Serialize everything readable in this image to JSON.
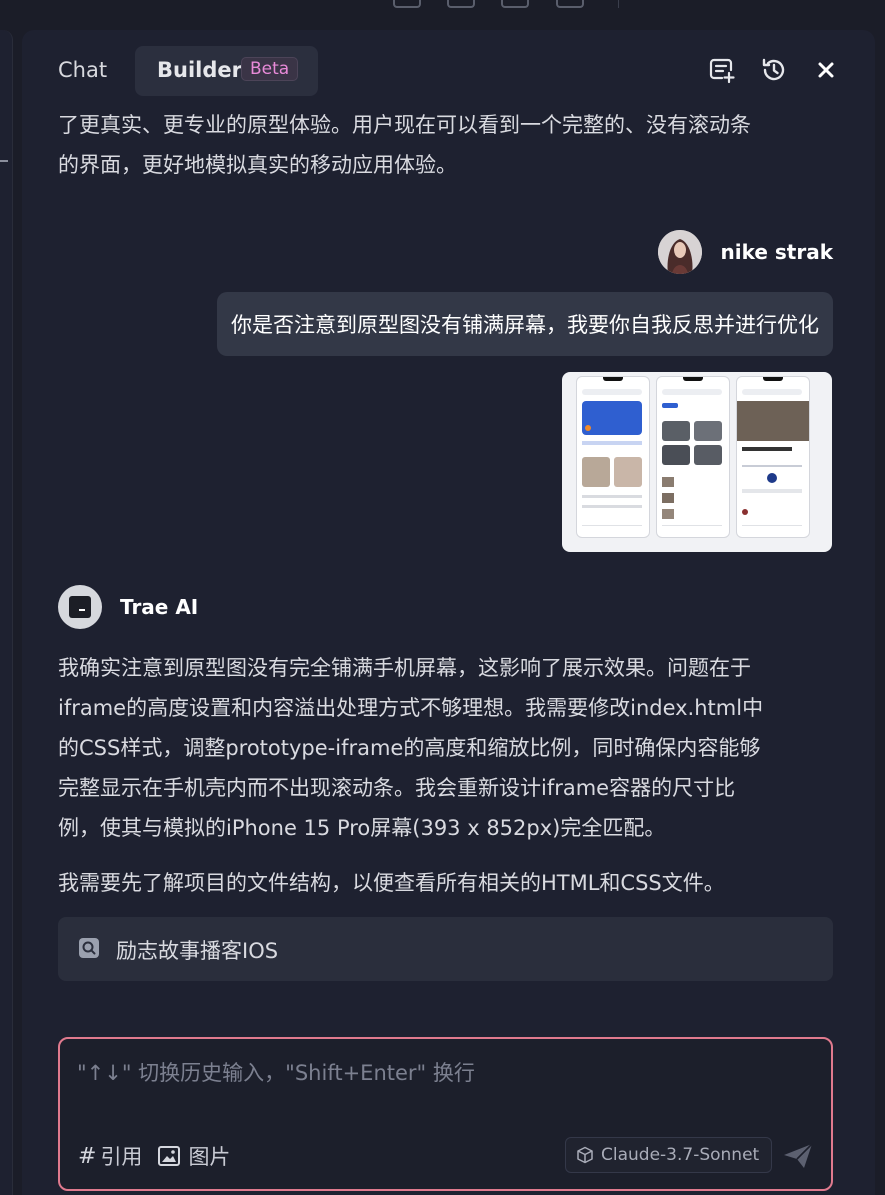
{
  "header": {
    "tab_chat": "Chat",
    "tab_builder": "Builder",
    "beta_badge": "Beta",
    "new_chat_icon": "new-chat-icon",
    "history_icon": "history-icon",
    "close_icon": "close-icon"
  },
  "messages": {
    "prev_line_1": "了更真实、更专业的原型体验。用户现在可以看到一个完整的、没有滚动条",
    "prev_line_2": "的界面，更好地模拟真实的移动应用体验。",
    "user_name": "nike strak",
    "user_message": "你是否注意到原型图没有铺满屏幕，我要你自我反思并进行优化",
    "ai_name": "Trae AI",
    "ai_lines": [
      "我确实注意到原型图没有完全铺满手机屏幕，这影响了展示效果。问题在于",
      "iframe的高度设置和内容溢出处理方式不够理想。我需要修改index.html中",
      "的CSS样式，调整prototype-iframe的高度和缩放比例，同时确保内容能够",
      "完整显示在手机壳内而不出现滚动条。我会重新设计iframe容器的尺寸比",
      "例，使其与模拟的iPhone 15 Pro屏幕(393 x 852px)完全匹配。"
    ],
    "ai_line_2": "我需要先了解项目的文件结构，以便查看所有相关的HTML和CSS文件。",
    "search_result": "励志故事播客IOS"
  },
  "input": {
    "placeholder": "\"↑↓\" 切换历史输入，\"Shift+Enter\" 换行",
    "reference_label": "引用",
    "image_label": "图片",
    "model_label": "Claude-3.7-Sonnet"
  },
  "colors": {
    "background": "#1b1d28",
    "panel": "#1e2130",
    "bubble": "#333847",
    "beta_text": "#e88ad8",
    "input_border": "#e07a8e"
  }
}
